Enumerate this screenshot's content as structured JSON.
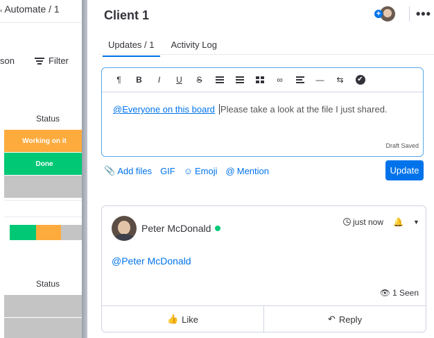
{
  "board": {
    "automate_label": "Automate / 1",
    "person_label": "son",
    "filter_label": "Filter",
    "status_header_1": "Status",
    "status_header_2": "Status",
    "cells": [
      "Working on it",
      "Done"
    ],
    "colors": {
      "working": "#fdab3d",
      "done": "#00c875",
      "empty": "#c4c4c4"
    }
  },
  "panel": {
    "title": "Client 1",
    "tabs": [
      {
        "label": "Updates / 1"
      },
      {
        "label": "Activity Log"
      }
    ],
    "more_label": "•••",
    "add_badge": "+"
  },
  "editor": {
    "toolbar": {
      "paragraph": "¶",
      "bold": "B",
      "italic": "I",
      "underline": "U",
      "strike": "S",
      "link": "🔗",
      "divider": "—",
      "direction": "⇆",
      "check": "✔"
    },
    "mention": "@Everyone on this board",
    "message": "Please take a look at the file I just shared.",
    "draft_status": "Draft Saved"
  },
  "actions": {
    "add_files": "Add files",
    "gif": "GIF",
    "emoji": "Emoji",
    "mention": "Mention",
    "update": "Update"
  },
  "post": {
    "author": "Peter McDonald",
    "time": "just now",
    "mention": "@Peter McDonald",
    "seen": "1 Seen",
    "like": "Like",
    "reply": "Reply",
    "bell": "🔔",
    "caret": "▼",
    "eye": "👁"
  },
  "accent": "#0073ea"
}
